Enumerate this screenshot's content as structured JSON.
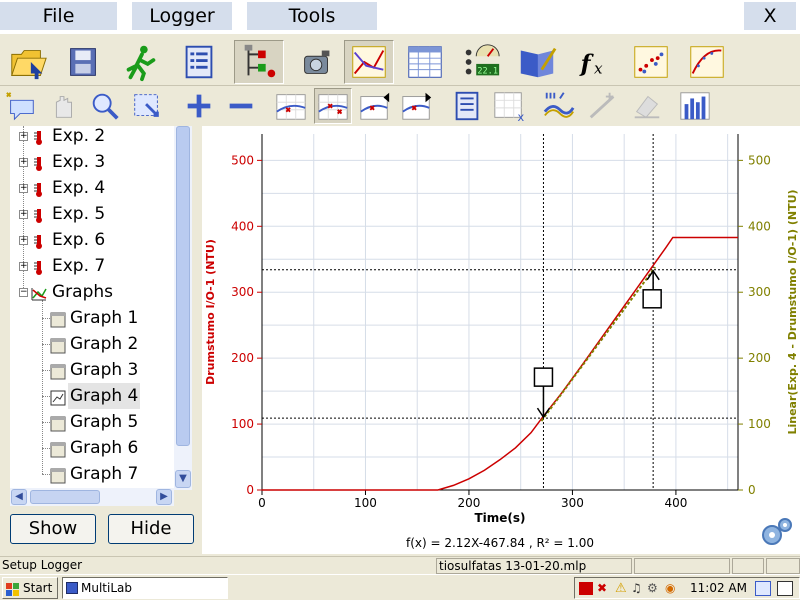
{
  "menubar": {
    "file": "File",
    "logger": "Logger",
    "tools": "Tools",
    "close": "X"
  },
  "toolbar_main": [
    "open-folder-icon",
    "save-disk-icon",
    "run-icon",
    "list-icon",
    "sensor-tree-icon",
    "camera-icon",
    "graph-icon",
    "table-icon",
    "meter-icon",
    "notebook-icon",
    "function-icon",
    "scatter-icon",
    "curve-fit-icon"
  ],
  "toolbar_graph": [
    "comment-icon",
    "hand-pan-icon",
    "zoom-icon",
    "zoom-box-icon",
    "plus-icon",
    "minus-icon",
    "cursor-icon",
    "add-cursor-icon",
    "prev-cursor-icon",
    "next-cursor-icon",
    "legend-icon",
    "axis-x-icon",
    "smooth-icon",
    "derivative-icon",
    "eraser-icon",
    "histogram-icon"
  ],
  "function_label": "fx",
  "tree": {
    "items": [
      {
        "label": "Exp. 2"
      },
      {
        "label": "Exp. 3"
      },
      {
        "label": "Exp. 4"
      },
      {
        "label": "Exp. 5"
      },
      {
        "label": "Exp. 6"
      },
      {
        "label": "Exp. 7"
      }
    ],
    "graphs_label": "Graphs",
    "graphs": [
      {
        "label": "Graph 1"
      },
      {
        "label": "Graph 2"
      },
      {
        "label": "Graph 3"
      },
      {
        "label": "Graph 4",
        "selected": true
      },
      {
        "label": "Graph 5"
      },
      {
        "label": "Graph 6"
      },
      {
        "label": "Graph 7"
      }
    ]
  },
  "buttons": {
    "show": "Show",
    "hide": "Hide"
  },
  "chart_data": {
    "type": "line",
    "xlabel": "Time(s)",
    "ylabel_left": "Drumstumo I/O-1 (NTU)",
    "ylabel_right": "Linear(Exp. 4 - Drumstumo I/O-1) (NTU)",
    "xlim": [
      0,
      460
    ],
    "ylim": [
      0,
      540
    ],
    "x_ticks": [
      0,
      100,
      200,
      300,
      400
    ],
    "y_ticks": [
      0,
      100,
      200,
      300,
      400,
      500
    ],
    "grid": true,
    "colors": {
      "primary": "#cc0000",
      "fit": "#808000"
    },
    "series": [
      {
        "name": "Drumstumo I/O-1",
        "x": [
          0,
          170,
          185,
          200,
          215,
          230,
          245,
          260,
          270,
          290,
          310,
          330,
          350,
          370,
          380,
          390,
          397,
          460
        ],
        "y": [
          0,
          0,
          7,
          17,
          30,
          46,
          64,
          87,
          108,
          148,
          191,
          235,
          279,
          323,
          345,
          367,
          383,
          383
        ]
      },
      {
        "name": "Linear fit",
        "x": [
          270,
          380
        ],
        "y": [
          104.6,
          338
        ]
      }
    ],
    "cursors": [
      {
        "x": 272,
        "y": 109
      },
      {
        "x": 378,
        "y": 334
      }
    ],
    "fit_equation": "f(x) = 2.12X-467.84 ,  R² = 1.00"
  },
  "statusbar": {
    "left": "Setup Logger",
    "file": "tiosulfatas 13-01-20.mlp"
  },
  "taskbar": {
    "start": "Start",
    "task": "MultiLab",
    "clock": "11:02 AM"
  }
}
